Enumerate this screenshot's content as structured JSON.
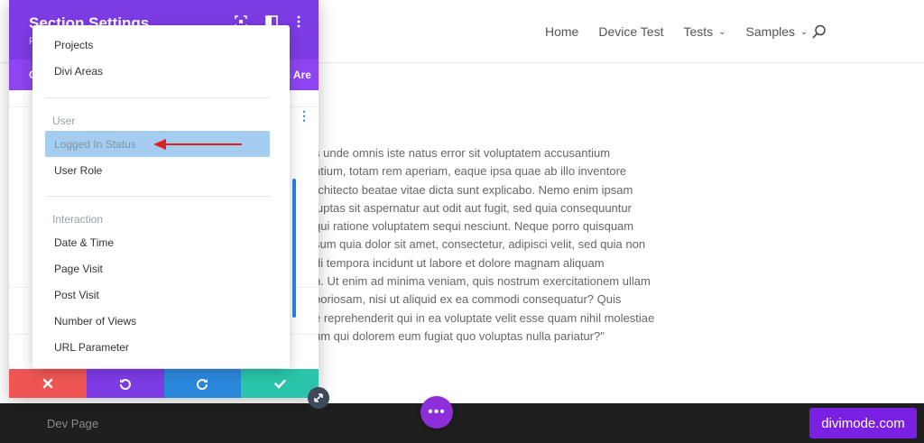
{
  "nav": {
    "links": [
      {
        "label": "Home",
        "dropdown": false
      },
      {
        "label": "Device Test",
        "dropdown": false
      },
      {
        "label": "Tests",
        "dropdown": true
      },
      {
        "label": "Samples",
        "dropdown": true
      }
    ],
    "search_icon": "search-icon"
  },
  "content": {
    "lines": [
      "s unde omnis iste natus error sit voluptatem accusantium",
      "ntium, totam rem aperiam, eaque ipsa quae ab illo inventore",
      "rchitecto beatae vitae dicta sunt explicabo. Nemo enim ipsam",
      "luptas sit aspernatur aut odit aut fugit, sed quia consequuntur",
      " qui ratione voluptatem sequi nesciunt. Neque porro quisquam",
      "sum quia dolor sit amet, consectetur, adipisci velit, sed quia non",
      "di tempora incidunt ut labore et dolore magnam aliquam",
      "n. Ut enim ad minima veniam, quis nostrum exercitationem ullam",
      "boriosam, nisi ut aliquid ex ea commodi consequatur? Quis",
      "e reprehenderit qui in ea voluptate velit esse quam nihil molestiae",
      "um qui dolorem eum fugiat quo voluptas nulla pariatur?\""
    ]
  },
  "modal": {
    "title": "Section Settings",
    "subtitle": "P",
    "tab_left": "C",
    "tab_right": "vi Are",
    "header_icons": [
      "expand-icon",
      "columns-icon",
      "kebab-icon"
    ],
    "actions": [
      "close-icon",
      "undo-icon",
      "redo-icon",
      "check-icon"
    ]
  },
  "dropdown": {
    "items_top": [
      "Projects",
      "Divi Areas"
    ],
    "group_user": "User",
    "user_items": [
      "Logged In Status",
      "User Role"
    ],
    "group_interaction": "Interaction",
    "interaction_items": [
      "Date & Time",
      "Page Visit",
      "Post Visit",
      "Number of Views",
      "URL Parameter"
    ],
    "highlighted": "Logged In Status"
  },
  "footer": {
    "label": "Dev Page",
    "brand": "divimode.com",
    "dots": "•••"
  },
  "colors": {
    "purple": "#7d3be4",
    "blue": "#2b87da",
    "red": "#ef5555",
    "teal": "#29c4a9",
    "highlight": "#a4cdef",
    "arrow": "#e02020"
  }
}
